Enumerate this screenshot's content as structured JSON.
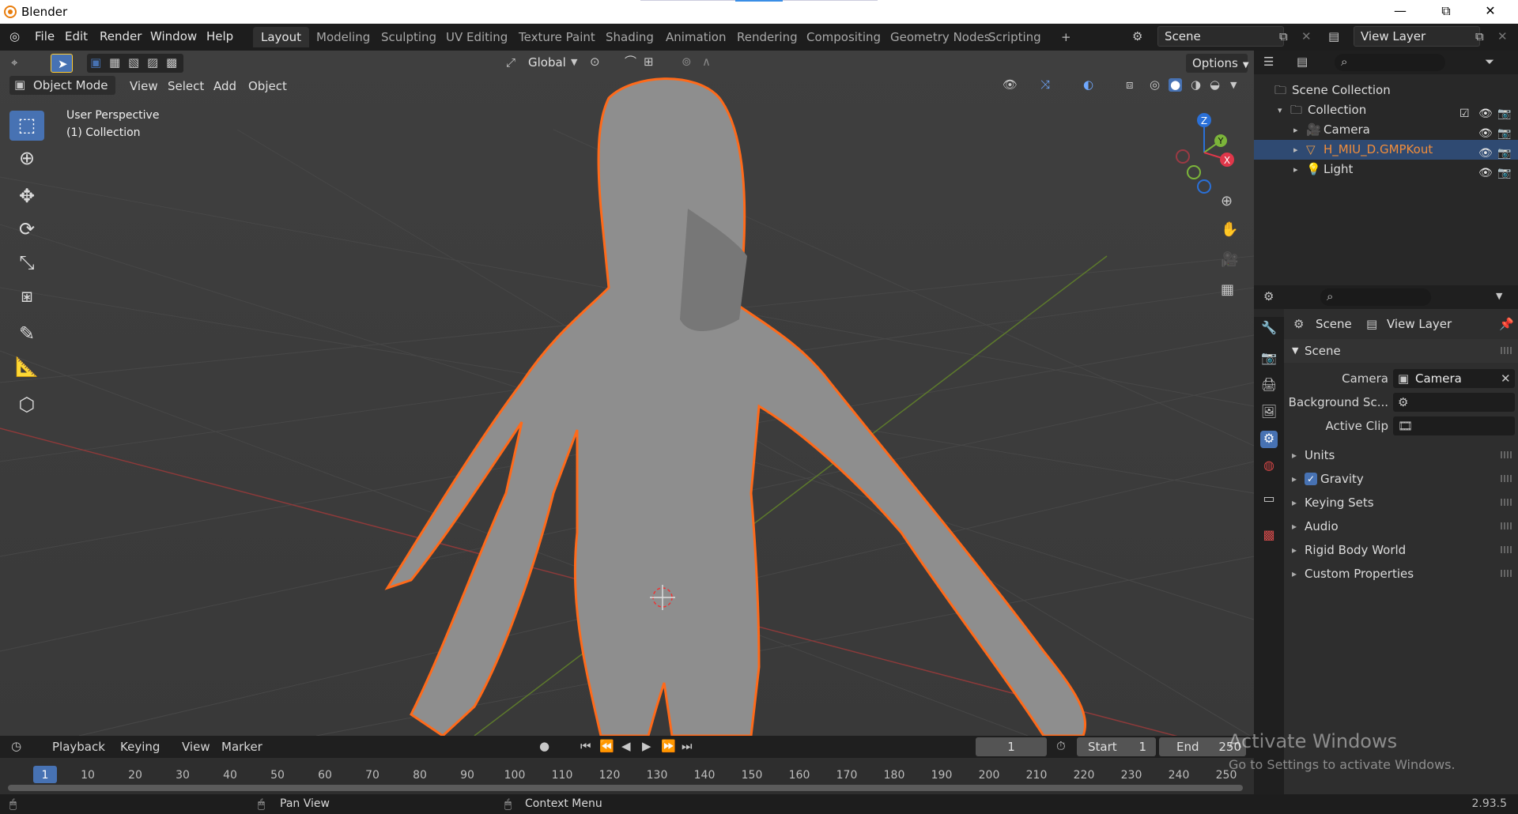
{
  "window": {
    "title": "Blender",
    "minimize": "—",
    "maximize": "⧉",
    "close": "✕"
  },
  "menus": [
    "File",
    "Edit",
    "Render",
    "Window",
    "Help"
  ],
  "workspaces": [
    "Layout",
    "Modeling",
    "Sculpting",
    "UV Editing",
    "Texture Paint",
    "Shading",
    "Animation",
    "Rendering",
    "Compositing",
    "Geometry Nodes",
    "Scripting",
    "+"
  ],
  "scene_selector": "Scene",
  "view_layer_selector": "View Layer",
  "viewport": {
    "mode": "Object Mode",
    "menus": [
      "View",
      "Select",
      "Add",
      "Object"
    ],
    "transform_orientation": "Global",
    "options_label": "Options",
    "overlay_text_1": "User Perspective",
    "overlay_text_2": "(1) Collection",
    "gizmo": {
      "z": "Z",
      "y": "Y",
      "x": "X"
    }
  },
  "outliner": {
    "rows": [
      {
        "label": "Scene Collection",
        "depth": 0
      },
      {
        "label": "Collection",
        "depth": 1
      },
      {
        "label": "Camera",
        "depth": 2
      },
      {
        "label": "H_MIU_D.GMPKout",
        "depth": 2,
        "selected": true,
        "color": "#f28d3a"
      },
      {
        "label": "Light",
        "depth": 2
      }
    ]
  },
  "properties": {
    "breadcrumb_scene": "Scene",
    "breadcrumb_viewlayer": "View Layer",
    "panel_title": "Scene",
    "camera_label": "Camera",
    "camera_value": "Camera",
    "background_label": "Background Sc...",
    "active_clip_label": "Active Clip",
    "subpanels": [
      "Units",
      "Gravity",
      "Keying Sets",
      "Audio",
      "Rigid Body World",
      "Custom Properties"
    ]
  },
  "timeline": {
    "menus": [
      "Playback",
      "Keying",
      "View",
      "Marker"
    ],
    "current_frame": "1",
    "start_label": "Start",
    "start_value": "1",
    "end_label": "End",
    "end_value": "250",
    "ticks": [
      "1",
      "10",
      "20",
      "30",
      "40",
      "50",
      "60",
      "70",
      "80",
      "90",
      "100",
      "110",
      "120",
      "130",
      "140",
      "150",
      "160",
      "170",
      "180",
      "190",
      "200",
      "210",
      "220",
      "230",
      "240",
      "250"
    ]
  },
  "statusbar": {
    "pan": "Pan View",
    "context": "Context Menu",
    "version": "2.93.5"
  },
  "watermark": {
    "line1": "Activate Windows",
    "line2": "Go to Settings to activate Windows."
  },
  "colors": {
    "accent": "#4772b3",
    "selection_outline": "#ff6a1a",
    "selected_text": "#f28d3a"
  }
}
